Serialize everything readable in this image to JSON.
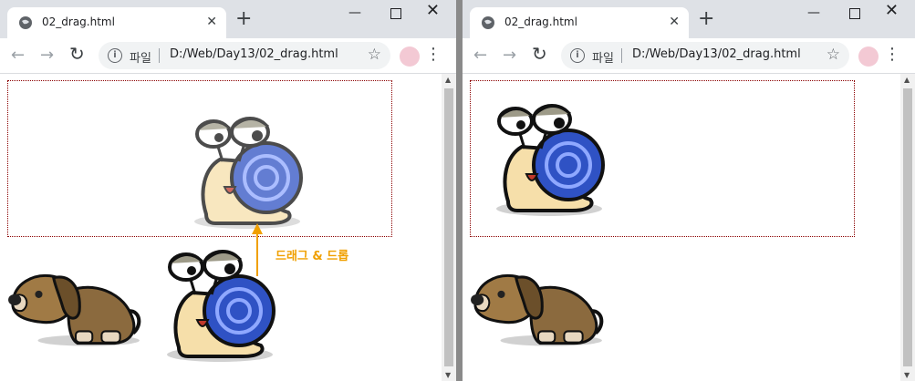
{
  "left_window": {
    "tab_title": "02_drag.html",
    "new_tab": "+",
    "omnibox": {
      "scheme": "파일",
      "url": "D:/Web/Day13/02_drag.html"
    },
    "drag_hint": "드래그 & 드롭"
  },
  "right_window": {
    "tab_title": "02_drag.html",
    "new_tab": "+",
    "omnibox": {
      "scheme": "파일",
      "url": "D:/Web/Day13/02_drag.html"
    }
  },
  "colors": {
    "dropzone_border": "#8b0000",
    "hint": "#f0a000",
    "titlebar": "#dee1e6"
  },
  "icons": [
    "globe-icon",
    "close-icon",
    "minimize-icon",
    "maximize-icon",
    "window-close-icon",
    "back-icon",
    "forward-icon",
    "reload-icon",
    "info-icon",
    "star-icon",
    "menu-icon"
  ]
}
